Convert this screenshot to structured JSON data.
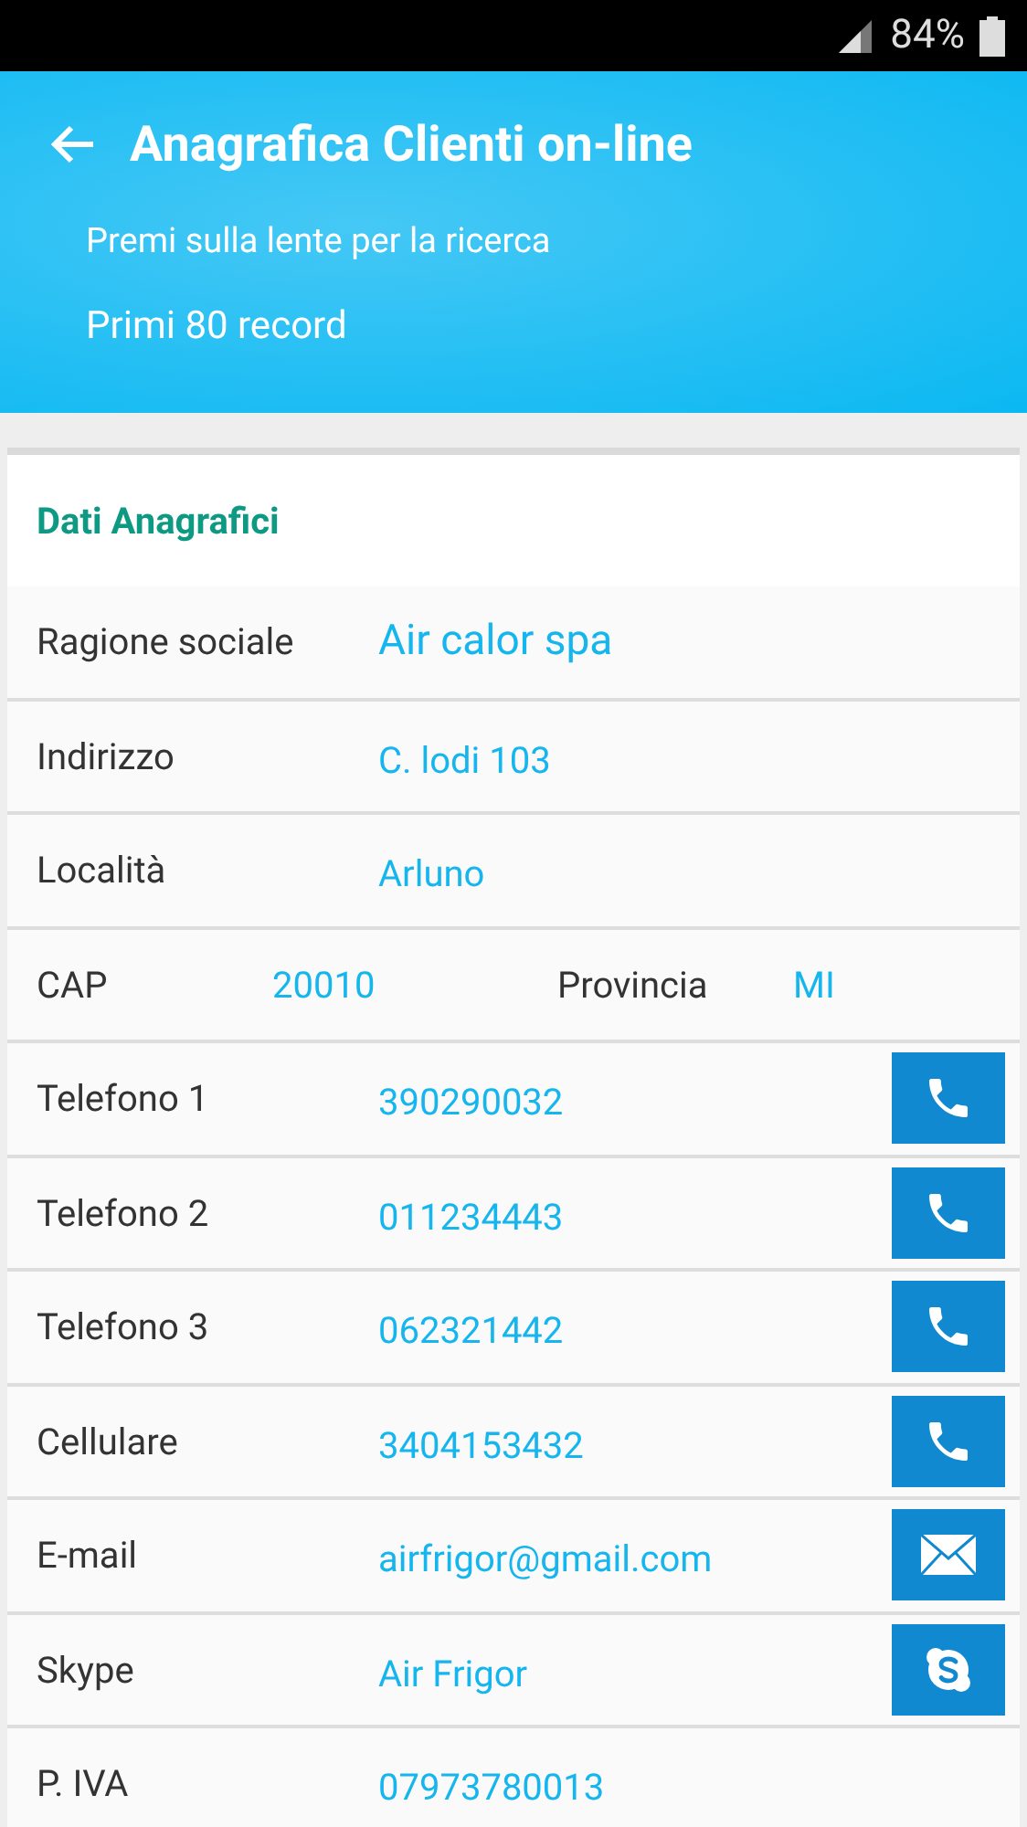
{
  "status_bar": {
    "battery": "84%"
  },
  "header": {
    "title": "Anagrafica Clienti on-line",
    "lines": [
      "Premi sulla lente per la ricerca",
      "Primi 80 record"
    ]
  },
  "section": {
    "title": "Dati Anagrafici"
  },
  "rows": [
    {
      "kind": "large",
      "label": "Ragione sociale",
      "value": "Air calor spa"
    },
    {
      "kind": "field",
      "label": "Indirizzo",
      "value": "C. lodi 103"
    },
    {
      "kind": "field",
      "label": "Località",
      "value": "Arluno"
    },
    {
      "kind": "pair",
      "label": "CAP",
      "value": "20010",
      "label_2": "Provincia",
      "value_2": "MI"
    },
    {
      "kind": "field",
      "label": "Telefono 1",
      "value": "390290032",
      "button": {
        "kind": "phone"
      }
    },
    {
      "kind": "field",
      "label": "Telefono 2",
      "value": "011234443",
      "button": {
        "kind": "phone"
      }
    },
    {
      "kind": "field",
      "label": "Telefono 3",
      "value": "062321442",
      "button": {
        "kind": "phone"
      }
    },
    {
      "kind": "field",
      "label": "Cellulare",
      "value": "3404153432",
      "button": {
        "kind": "phone"
      }
    },
    {
      "kind": "field",
      "label": "E-mail",
      "value": "airfrigor@gmail.com",
      "button": {
        "kind": "email"
      }
    },
    {
      "kind": "field",
      "label": "Skype",
      "value": "Air Frigor",
      "button": {
        "kind": "skype"
      }
    },
    {
      "kind": "field",
      "label": "P. IVA",
      "value": "07973780013"
    }
  ]
}
